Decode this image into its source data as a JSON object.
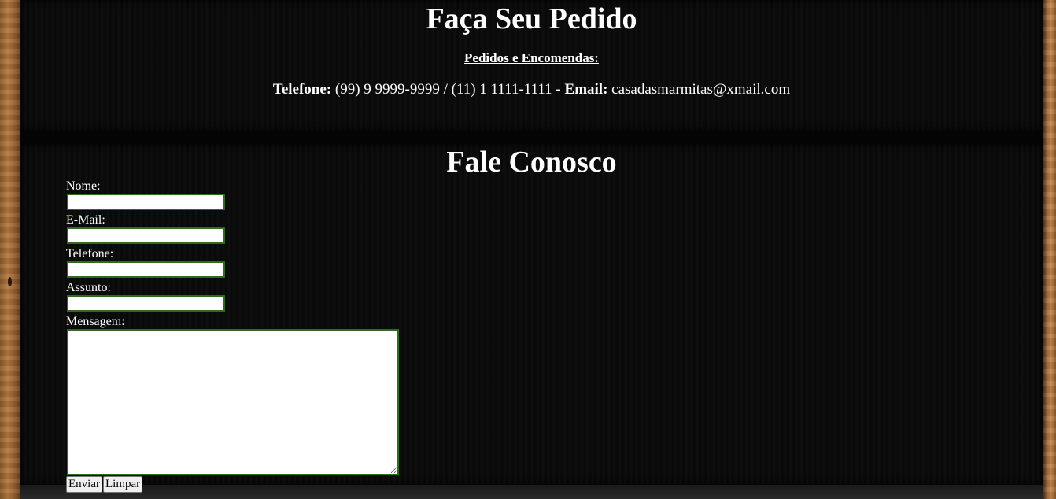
{
  "order": {
    "title": "Faça Seu Pedido",
    "subtitle": "Pedidos e Encomendas:",
    "phone_label": "Telefone:",
    "phone_value": "(99) 9 9999-9999 / (11) 1 1111-1111 -",
    "email_label": "Email:",
    "email_value": "casadasmarmitas@xmail.com"
  },
  "contact": {
    "title": "Fale Conosco",
    "fields": {
      "name_label": "Nome:",
      "name_value": "",
      "email_label": "E-Mail:",
      "email_value": "",
      "phone_label": "Telefone:",
      "phone_value": "",
      "subject_label": "Assunto:",
      "subject_value": "",
      "message_label": "Mensagem:",
      "message_value": ""
    },
    "submit_label": "Enviar",
    "reset_label": "Limpar"
  },
  "colors": {
    "panel": "#0a0a0a",
    "field_border": "#2e6b1e",
    "text": "#ffffff"
  }
}
